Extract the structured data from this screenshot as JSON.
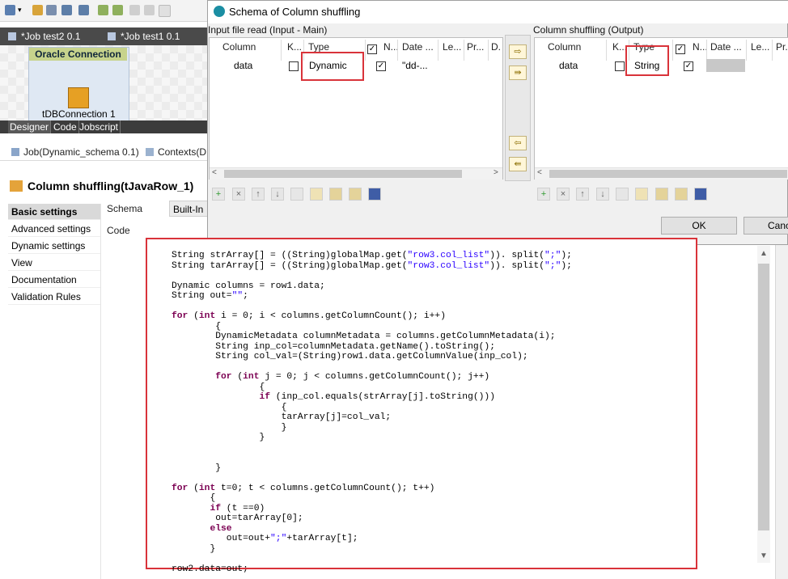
{
  "job_tabs": [
    "*Job test2 0.1",
    "*Job test1 0.1"
  ],
  "canvas": {
    "connection_title": "Oracle Connection",
    "component_label": "tDBConnection 1"
  },
  "view_tabs": [
    "Designer",
    "Code",
    "Jobscript"
  ],
  "component_tabs": [
    "Job(Dynamic_schema 0.1)",
    "Contexts(D"
  ],
  "component_title": "Column shuffling(tJavaRow_1)",
  "side_menu": [
    "Basic settings",
    "Advanced settings",
    "Dynamic settings",
    "View",
    "Documentation",
    "Validation Rules"
  ],
  "fields": {
    "schema_label": "Schema",
    "schema_value": "Built-In",
    "code_label": "Code"
  },
  "dialog": {
    "title": "Schema of Column shuffling",
    "input_label": "Input file read (Input - Main)",
    "output_label": "Column shuffling (Output)",
    "input_headers": [
      "Column",
      "K...",
      "Type",
      "N...",
      "Date ...",
      "Le...",
      "Pr...",
      "D."
    ],
    "input_row": {
      "column": "data",
      "type": "Dynamic",
      "date": "\"dd-..."
    },
    "output_headers": [
      "Column",
      "K...",
      "Type",
      "N...",
      "Date ...",
      "Le...",
      "Pr..."
    ],
    "output_row": {
      "column": "data",
      "type": "String"
    },
    "ok_label": "OK",
    "cancel_label": "Canc"
  },
  "code_lines": [
    "String strArray[] = ((String)globalMap.get(\"row3.col_list\")). split(\";\");",
    "String tarArray[] = ((String)globalMap.get(\"row3.col_list\")). split(\";\");",
    "",
    "Dynamic columns = row1.data;",
    "String out=\"\";",
    "",
    "for (int i = 0; i < columns.getColumnCount(); i++)",
    "        {",
    "        DynamicMetadata columnMetadata = columns.getColumnMetadata(i);",
    "        String inp_col=columnMetadata.getName().toString();",
    "        String col_val=(String)row1.data.getColumnValue(inp_col);",
    "",
    "        for (int j = 0; j < columns.getColumnCount(); j++)",
    "                {",
    "                if (inp_col.equals(strArray[j].toString()))",
    "                    {",
    "                    tarArray[j]=col_val;",
    "                    }",
    "                }",
    "",
    "",
    "        }",
    "",
    "for (int t=0; t < columns.getColumnCount(); t++)",
    "       {",
    "       if (t ==0)",
    "        out=tarArray[0];",
    "       else",
    "          out=out+\";\"+tarArray[t];",
    "       }",
    "",
    "row2.data=out;"
  ]
}
